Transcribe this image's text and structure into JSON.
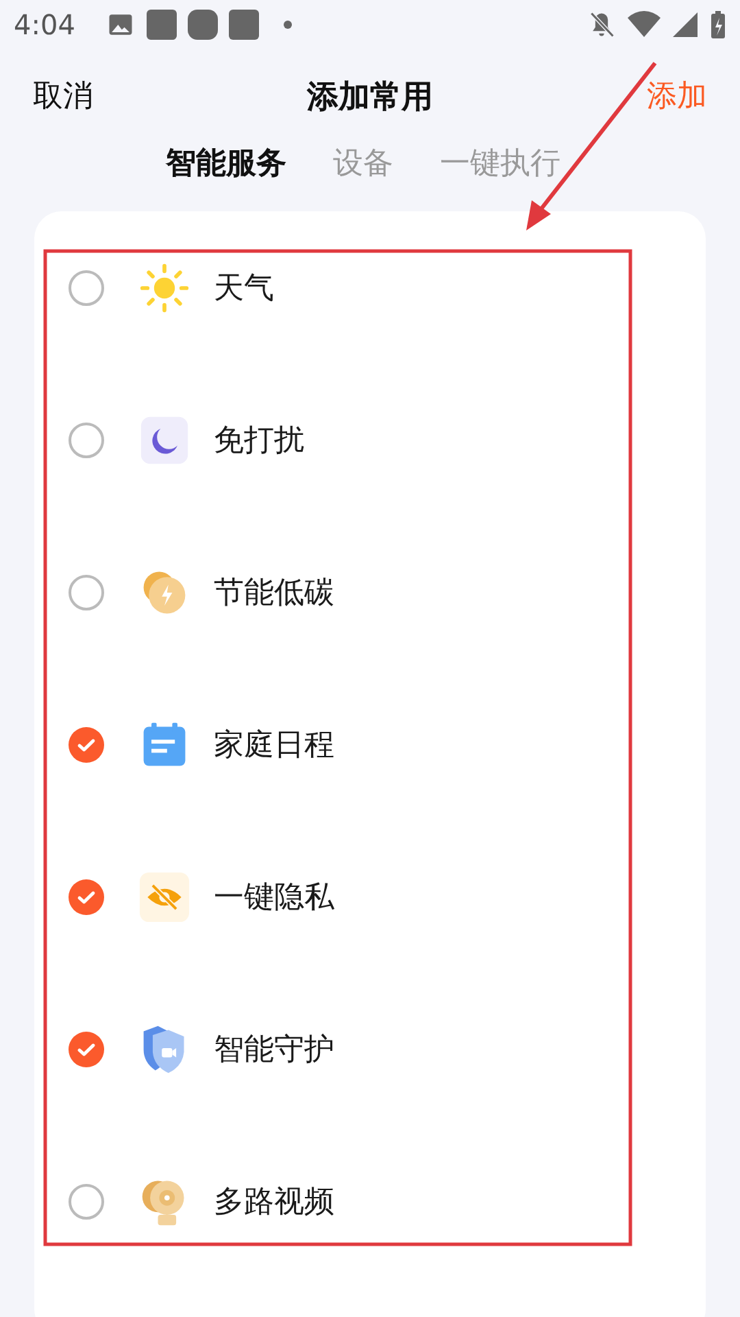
{
  "status_bar": {
    "time": "4:04"
  },
  "header": {
    "cancel": "取消",
    "title": "添加常用",
    "add": "添加"
  },
  "tabs": [
    {
      "label": "智能服务",
      "selected": true
    },
    {
      "label": "设备",
      "selected": false
    },
    {
      "label": "一键执行",
      "selected": false
    }
  ],
  "items": [
    {
      "kind": "weather",
      "label": "天气",
      "checked": false
    },
    {
      "kind": "moon",
      "label": "免打扰",
      "checked": false
    },
    {
      "kind": "energy",
      "label": "节能低碳",
      "checked": false
    },
    {
      "kind": "calendar",
      "label": "家庭日程",
      "checked": true
    },
    {
      "kind": "privacy",
      "label": "一键隐私",
      "checked": true
    },
    {
      "kind": "shield",
      "label": "智能守护",
      "checked": true
    },
    {
      "kind": "camera",
      "label": "多路视频",
      "checked": false
    }
  ]
}
